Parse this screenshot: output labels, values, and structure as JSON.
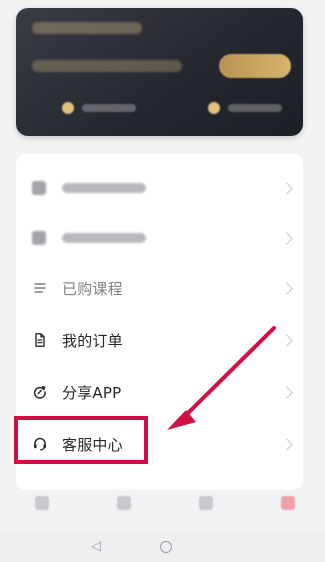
{
  "menu": {
    "items": [
      {
        "label": "已购课程",
        "icon": "list-icon"
      },
      {
        "label": "我的订单",
        "icon": "document-icon"
      },
      {
        "label": "分享APP",
        "icon": "share-icon"
      },
      {
        "label": "客服中心",
        "icon": "headset-icon"
      }
    ]
  },
  "annotation": {
    "box_color": "#d10f43",
    "arrow_color": "#d10f43"
  },
  "navigation": {
    "icons": [
      "back-icon",
      "home-icon"
    ]
  }
}
